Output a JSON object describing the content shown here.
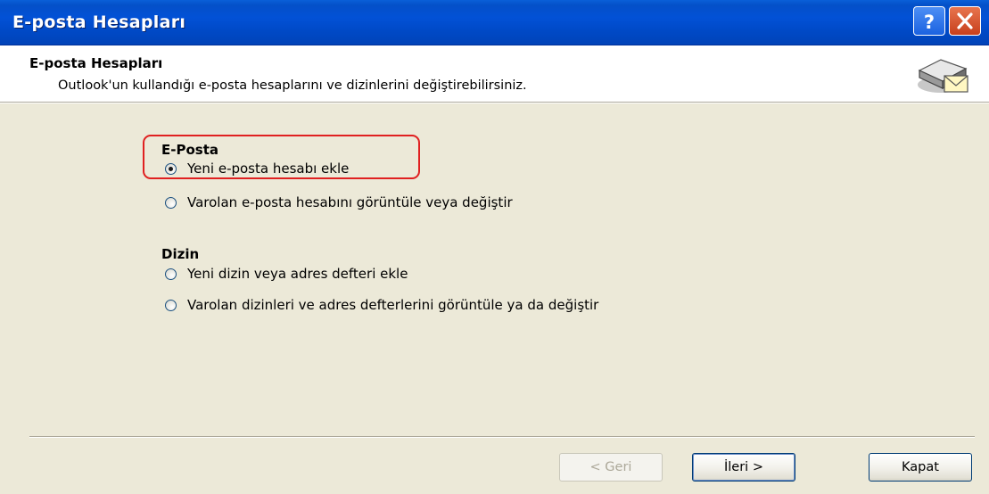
{
  "window": {
    "title": "E-posta Hesapları",
    "help_button": "?",
    "close_button": "X"
  },
  "header": {
    "title": "E-posta Hesapları",
    "description": "Outlook'un kullandığı e-posta hesaplarını ve dizinlerini değiştirebilirsiniz.",
    "icon": "mail-server-icon"
  },
  "groups": {
    "email": {
      "label": "E-Posta",
      "options": [
        {
          "label": "Yeni e-posta hesabı ekle",
          "selected": true
        },
        {
          "label": "Varolan e-posta hesabını görüntüle veya değiştir",
          "selected": false
        }
      ]
    },
    "directory": {
      "label": "Dizin",
      "options": [
        {
          "label": "Yeni dizin veya adres defteri ekle",
          "selected": false
        },
        {
          "label": "Varolan dizinleri ve adres defterlerini görüntüle ya da değiştir",
          "selected": false
        }
      ]
    }
  },
  "buttons": {
    "back": {
      "label": "< Geri",
      "enabled": false
    },
    "next": {
      "label": "İleri >",
      "enabled": true
    },
    "close": {
      "label": "Kapat",
      "enabled": true
    }
  },
  "colors": {
    "titlebar": "#0251d6",
    "dialog_bg": "#ece9d8",
    "highlight": "#e02020"
  }
}
